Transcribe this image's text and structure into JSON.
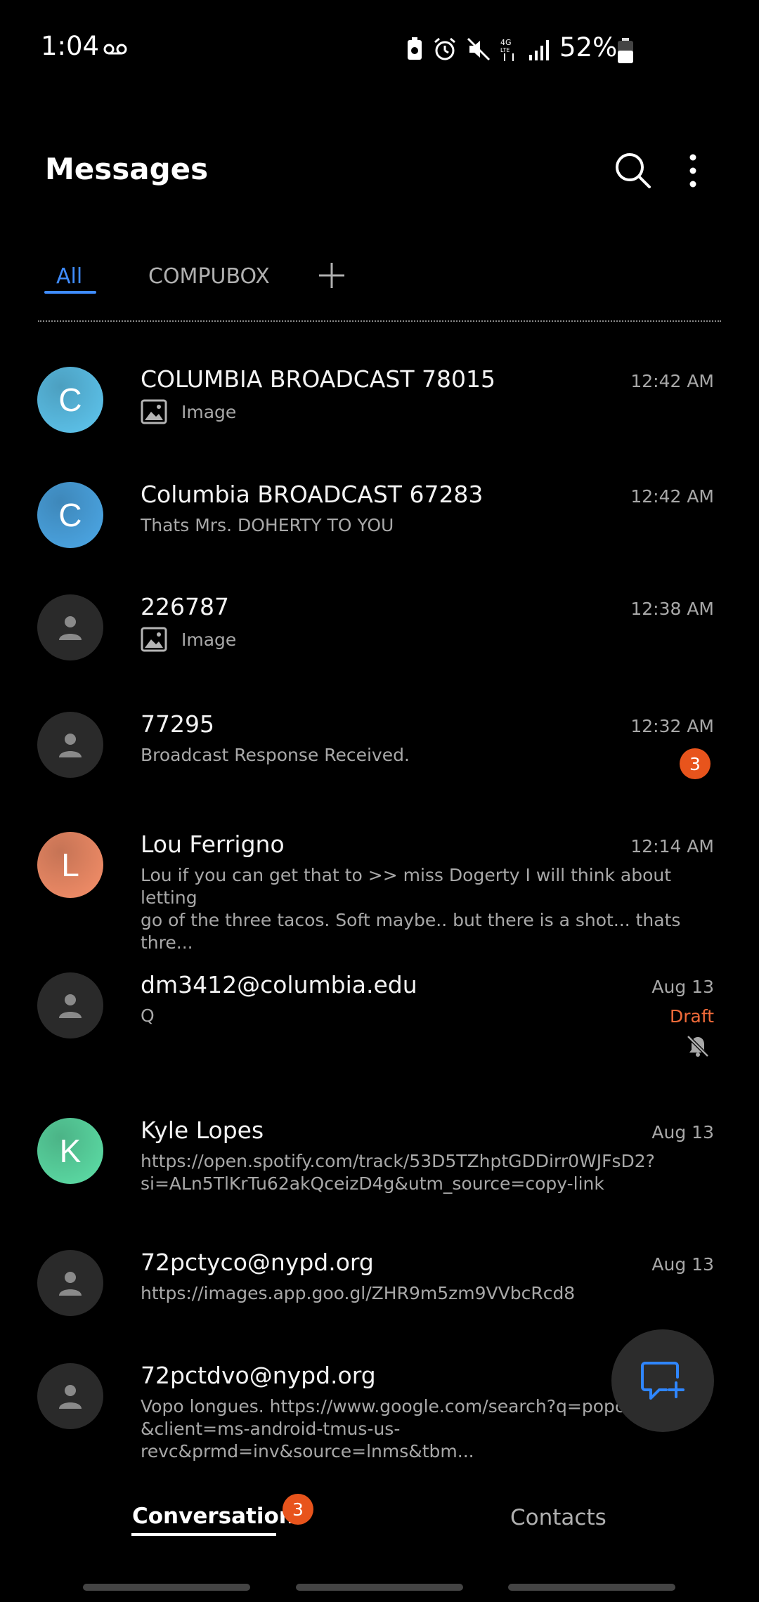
{
  "status_bar": {
    "time": "1:04",
    "battery_percent": "52%",
    "icons": [
      "voicemail-icon",
      "battery-saver-icon",
      "alarm-icon",
      "mute-icon",
      "4g-lte-icon",
      "signal-icon",
      "battery-icon"
    ]
  },
  "header": {
    "title": "Messages",
    "icons": [
      "search-icon",
      "more-options-icon"
    ]
  },
  "tabs": {
    "items": [
      {
        "label": "All",
        "active": true
      },
      {
        "label": "COMPUBOX",
        "active": false
      }
    ],
    "add_icon": "plus-icon"
  },
  "conversations": [
    {
      "avatar_letter": "C",
      "avatar_color": "#5fc7f0",
      "name": "COLUMBIA BROADCAST 78015",
      "preview": "Image",
      "preview_type": "image",
      "time": "12:42 AM"
    },
    {
      "avatar_letter": "C",
      "avatar_color": "#4da9e8",
      "name": "Columbia BROADCAST 67283",
      "preview": "Thats Mrs. DOHERTY TO YOU",
      "preview_type": "text",
      "time": "12:42 AM"
    },
    {
      "avatar_letter": "",
      "avatar_color": "#2a2a2a",
      "name": "226787",
      "preview": "Image",
      "preview_type": "image",
      "time": "12:38 AM"
    },
    {
      "avatar_letter": "",
      "avatar_color": "#2a2a2a",
      "name": "77295",
      "preview": "Broadcast Response Received.",
      "preview_type": "text",
      "time": "12:32 AM",
      "unread": "3"
    },
    {
      "avatar_letter": "L",
      "avatar_color": "#f7906a",
      "name": "Lou Ferrigno",
      "preview": "Lou if you can get that to >> miss Dogerty I will think about letting\ngo of the three tacos. Soft maybe.. but there is a shot... thats thre...",
      "preview_type": "text",
      "time": "12:14 AM"
    },
    {
      "avatar_letter": "",
      "avatar_color": "#2a2a2a",
      "name": "dm3412@columbia.edu",
      "preview": "Q",
      "preview_type": "text",
      "time": "Aug 13",
      "draft": "Draft",
      "muted": true
    },
    {
      "avatar_letter": "K",
      "avatar_color": "#5ee0a8",
      "name": "Kyle Lopes",
      "preview": "https://open.spotify.com/track/53D5TZhptGDDirr0WJFsD2?\nsi=ALn5TlKrTu62akQceizD4g&utm_source=copy-link",
      "preview_type": "text",
      "time": "Aug 13"
    },
    {
      "avatar_letter": "",
      "avatar_color": "#2a2a2a",
      "name": "72pctyco@nypd.org",
      "preview": "https://images.app.goo.gl/ZHR9m5zm9VVbcRcd8",
      "preview_type": "text",
      "time": "Aug 13"
    },
    {
      "avatar_letter": "",
      "avatar_color": "#2a2a2a",
      "name": "72pctdvo@nypd.org",
      "preview": "Vopo longues. https://www.google.com/search?q=popcorn\n&client=ms-android-tmus-us-revc&prmd=inv&source=lnms&tbm...",
      "preview_type": "text",
      "time": ""
    }
  ],
  "fab": {
    "icon": "new-message-icon",
    "color": "#2f86ff"
  },
  "bottom_nav": {
    "conversations_label": "Conversations",
    "conversations_badge": "3",
    "contacts_label": "Contacts"
  }
}
